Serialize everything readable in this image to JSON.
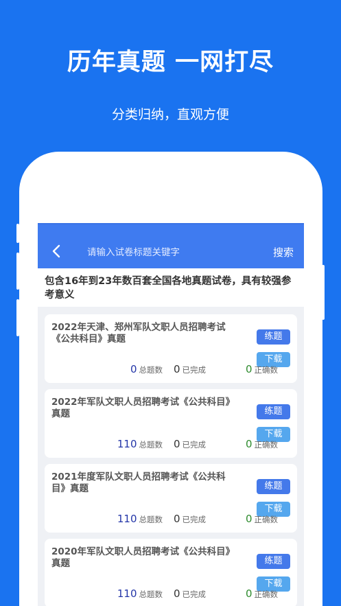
{
  "promo": {
    "headline": "历年真题 一网打尽",
    "subline": "分类归纳，直观方便"
  },
  "navbar": {
    "back_icon": "chevron-left-icon",
    "search_placeholder": "请输入试卷标题关键字",
    "search_label": "搜索"
  },
  "notice": "包含16年到23年数百套全国各地真题试卷，具有较强参考意义",
  "labels": {
    "practice": "练题",
    "download": "下载",
    "total": "总题数",
    "done": "已完成",
    "correct": "正确数"
  },
  "papers": [
    {
      "title": "2022年天津、郑州军队文职人员招聘考试《公共科目》真题",
      "total": "0",
      "done": "0",
      "correct": "0"
    },
    {
      "title": "2022年军队文职人员招聘考试《公共科目》真题",
      "total": "110",
      "done": "0",
      "correct": "0"
    },
    {
      "title": "2021年度军队文职人员招聘考试《公共科目》真题",
      "total": "110",
      "done": "0",
      "correct": "0"
    },
    {
      "title": "2020年军队文职人员招聘考试《公共科目》真题",
      "total": "110",
      "done": "0",
      "correct": "0"
    }
  ],
  "colors": {
    "background": "#1a73f0",
    "navbar": "#3f7bf0",
    "practice_button": "#4479ea",
    "download_button": "#55a7ee",
    "total_number": "#2436a8",
    "correct_number": "#2e8b2e"
  }
}
